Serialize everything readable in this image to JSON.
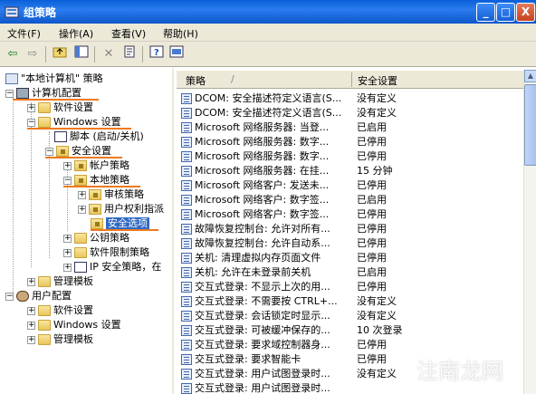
{
  "window": {
    "title": "组策略",
    "buttons": {
      "minimize": "_",
      "maximize": "□",
      "close": "X"
    }
  },
  "menu": [
    {
      "label": "文件(F)"
    },
    {
      "label": "操作(A)"
    },
    {
      "label": "查看(V)"
    },
    {
      "label": "帮助(H)"
    }
  ],
  "toolbar": [
    "back-icon",
    "forward-icon",
    "up-folder-icon",
    "show-hide-tree-icon",
    "delete-icon",
    "properties-icon",
    "help-icon",
    "console-icon"
  ],
  "tree": [
    {
      "label": "\"本地计算机\" 策略",
      "icon": "policy"
    },
    {
      "label": "计算机配置",
      "icon": "computer"
    },
    {
      "label": "软件设置",
      "icon": "folder"
    },
    {
      "label": "Windows 设置",
      "icon": "folder"
    },
    {
      "label": "脚本 (启动/关机)",
      "icon": "script"
    },
    {
      "label": "安全设置",
      "icon": "lock"
    },
    {
      "label": "帐户策略",
      "icon": "lock"
    },
    {
      "label": "本地策略",
      "icon": "lock"
    },
    {
      "label": "审核策略",
      "icon": "lock"
    },
    {
      "label": "用户权利指派",
      "icon": "lock"
    },
    {
      "label": "安全选项",
      "icon": "lock"
    },
    {
      "label": "公钥策略",
      "icon": "folder"
    },
    {
      "label": "软件限制策略",
      "icon": "folder"
    },
    {
      "label": "IP 安全策略，在",
      "icon": "ipsec"
    },
    {
      "label": "管理模板",
      "icon": "folder"
    },
    {
      "label": "用户配置",
      "icon": "user"
    },
    {
      "label": "软件设置",
      "icon": "folder"
    },
    {
      "label": "Windows 设置",
      "icon": "folder"
    },
    {
      "label": "管理模板",
      "icon": "folder"
    }
  ],
  "list": {
    "columns": {
      "policy": "策略",
      "setting": "安全设置"
    },
    "rows": [
      {
        "name": "DCOM: 安全描述符定义语言(S...",
        "value": "没有定义"
      },
      {
        "name": "DCOM: 安全描述符定义语言(S...",
        "value": "没有定义"
      },
      {
        "name": "Microsoft 网络服务器: 当登...",
        "value": "已启用"
      },
      {
        "name": "Microsoft 网络服务器: 数字...",
        "value": "已停用"
      },
      {
        "name": "Microsoft 网络服务器: 数字...",
        "value": "已停用"
      },
      {
        "name": "Microsoft 网络服务器: 在挂...",
        "value": "15 分钟"
      },
      {
        "name": "Microsoft 网络客户: 发送未...",
        "value": "已停用"
      },
      {
        "name": "Microsoft 网络客户: 数字签...",
        "value": "已启用"
      },
      {
        "name": "Microsoft 网络客户: 数字签...",
        "value": "已停用"
      },
      {
        "name": "故障恢复控制台: 允许对所有...",
        "value": "已停用"
      },
      {
        "name": "故障恢复控制台: 允许自动系...",
        "value": "已停用"
      },
      {
        "name": "关机: 清理虚拟内存页面文件",
        "value": "已停用"
      },
      {
        "name": "关机: 允许在未登录前关机",
        "value": "已启用"
      },
      {
        "name": "交互式登录: 不显示上次的用...",
        "value": "已停用"
      },
      {
        "name": "交互式登录: 不需要按 CTRL+...",
        "value": "没有定义"
      },
      {
        "name": "交互式登录: 会话锁定时显示...",
        "value": "没有定义"
      },
      {
        "name": "交互式登录: 可被缓冲保存的...",
        "value": "10 次登录"
      },
      {
        "name": "交互式登录: 要求域控制器身...",
        "value": "已停用"
      },
      {
        "name": "交互式登录: 要求智能卡",
        "value": "已停用"
      },
      {
        "name": "交互式登录: 用户试图登录时...",
        "value": "没有定义"
      },
      {
        "name": "交互式登录: 用户试图登录时...",
        "value": ""
      }
    ]
  },
  "watermark": "注南龙网"
}
